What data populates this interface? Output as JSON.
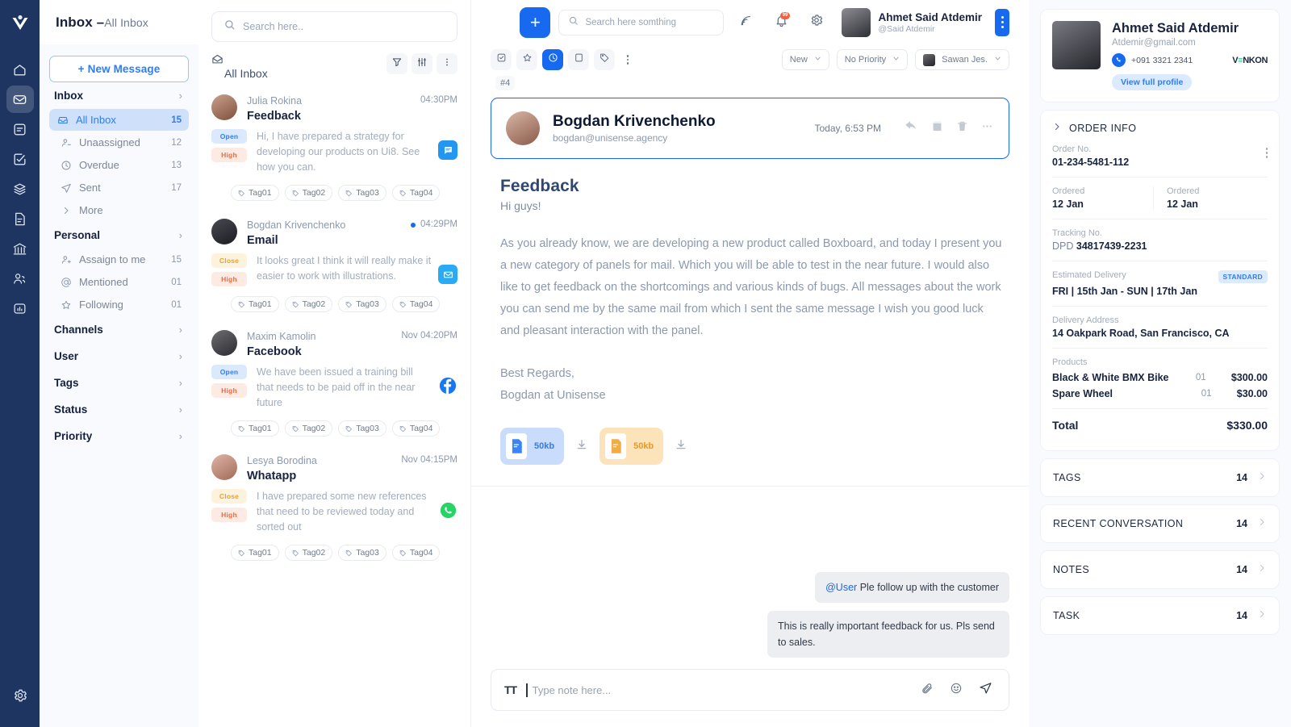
{
  "rail": {
    "logo_icon": "vexel-logo-icon",
    "items": [
      {
        "icon": "home-icon",
        "active": false
      },
      {
        "icon": "inbox-envelope-icon",
        "active": true
      },
      {
        "icon": "notes-icon",
        "active": false
      },
      {
        "icon": "tasks-check-icon",
        "active": false
      },
      {
        "icon": "layers-icon",
        "active": false
      },
      {
        "icon": "document-icon",
        "active": false
      },
      {
        "icon": "bank-icon",
        "active": false
      },
      {
        "icon": "contacts-icon",
        "active": false
      },
      {
        "icon": "analytics-icon",
        "active": false
      }
    ],
    "settings_icon": "gear-icon"
  },
  "sidebar": {
    "title": "Inbox –",
    "subtitle": "All Inbox",
    "new_message_label": "New Message",
    "sections": [
      {
        "label": "Inbox"
      },
      {
        "label": "Personal"
      },
      {
        "label": "Channels"
      },
      {
        "label": "User"
      },
      {
        "label": "Tags"
      },
      {
        "label": "Status"
      },
      {
        "label": "Priority"
      }
    ],
    "inbox_items": [
      {
        "label": "All Inbox",
        "count": "15",
        "icon": "inbox-icon",
        "active": true
      },
      {
        "label": "Unaassigned",
        "count": "12",
        "icon": "user-minus-icon",
        "active": false
      },
      {
        "label": "Overdue",
        "count": "13",
        "icon": "clock-icon",
        "active": false
      },
      {
        "label": "Sent",
        "count": "17",
        "icon": "send-icon",
        "active": false
      },
      {
        "label": "More",
        "count": "",
        "icon": "chevron-right-icon",
        "active": false
      }
    ],
    "personal_items": [
      {
        "label": "Assaign to me",
        "count": "15",
        "icon": "user-plus-icon"
      },
      {
        "label": "Mentioned",
        "count": "01",
        "icon": "at-icon"
      },
      {
        "label": "Following",
        "count": "01",
        "icon": "star-icon"
      }
    ]
  },
  "list": {
    "search_placeholder": "Search here..",
    "header_label": "All Inbox",
    "header_icon": "open-envelope-icon",
    "actions": [
      {
        "icon": "filter-icon"
      },
      {
        "icon": "sliders-icon"
      },
      {
        "icon": "kebab-icon"
      }
    ],
    "messages": [
      {
        "name": "Julia Rokina",
        "time": "04:30PM",
        "subject": "Feedback",
        "preview": "Hi, I have prepared a strategy for developing our products on Ui8. See how you can.",
        "status_badge": "Open",
        "priority_badge": "High",
        "channel": "chat",
        "unread": false,
        "tags": [
          "Tag01",
          "Tag02",
          "Tag03",
          "Tag04"
        ]
      },
      {
        "name": "Bogdan Krivenchenko",
        "time": "04:29PM",
        "subject": "Email",
        "preview": "It looks great I think it will really make it easier to work with illustrations.",
        "status_badge": "Close",
        "priority_badge": "High",
        "channel": "email",
        "unread": true,
        "tags": [
          "Tag01",
          "Tag02",
          "Tag03",
          "Tag04"
        ]
      },
      {
        "name": "Maxim Kamolin",
        "time": "Nov 04:20PM",
        "subject": "Facebook",
        "preview": "We have been issued a training bill that needs to be paid off in the near future",
        "status_badge": "Open",
        "priority_badge": "High",
        "channel": "facebook",
        "unread": false,
        "tags": [
          "Tag01",
          "Tag02",
          "Tag03",
          "Tag04"
        ]
      },
      {
        "name": "Lesya Borodina",
        "time": "Nov 04:15PM",
        "subject": "Whatapp",
        "preview": "I have prepared some new references that need to be reviewed today and sorted out",
        "status_badge": "Close",
        "priority_badge": "High",
        "channel": "whatsapp",
        "unread": false,
        "tags": [
          "Tag01",
          "Tag02",
          "Tag03",
          "Tag04"
        ]
      }
    ]
  },
  "topbar": {
    "add_label": "+",
    "search_placeholder": "Search here somthing",
    "icons": [
      {
        "name": "signal-icon"
      },
      {
        "name": "notification-bell-icon",
        "badge": "99"
      },
      {
        "name": "gear-icon"
      }
    ],
    "user_name": "Ahmet Said Atdemir",
    "user_handle": "@Said Atdemir"
  },
  "mail_toolbar": {
    "buttons": [
      {
        "icon": "check-square-icon",
        "active": false
      },
      {
        "icon": "star-icon",
        "active": false
      },
      {
        "icon": "clock-icon",
        "active": true
      },
      {
        "icon": "archive-icon",
        "active": false
      },
      {
        "icon": "tag-icon",
        "active": false
      }
    ],
    "status_select": "New",
    "priority_select": "No Priority",
    "assignee_select": "Sawan Jes.",
    "thread_number": "#4"
  },
  "mail": {
    "sender_name": "Bogdan Krivenchenko",
    "sender_email": "bogdan@unisense.agency",
    "date": "Today, 6:53 PM",
    "actions": [
      {
        "icon": "reply-icon"
      },
      {
        "icon": "archive-box-icon"
      },
      {
        "icon": "trash-icon"
      },
      {
        "icon": "more-dots-icon"
      }
    ],
    "subject": "Feedback",
    "greeting": "Hi guys!",
    "paragraph": "As you already know, we are developing a new product called Boxboard, and today I present you a new category of panels for mail. Which you will be able to test in the near future. I would also like to get feedback on the shortcomings and various kinds of bugs. All messages about the work you can send me by the same mail from which I sent the same message I wish you good luck and pleasant interaction with the panel.",
    "signoff_line1": "Best Regards,",
    "signoff_line2": "Bogdan at Unisense",
    "attachments": [
      {
        "size": "50kb",
        "color": "blue"
      },
      {
        "size": "50kb",
        "color": "orange"
      }
    ],
    "comments": [
      {
        "mention": "@User",
        "text": "Ple follow up with the customer"
      },
      {
        "mention": "",
        "text": "This is really important feedback for us. Pls send to sales."
      }
    ]
  },
  "composer": {
    "format_label": "TT",
    "placeholder": "Type note here...",
    "actions": [
      {
        "icon": "attachment-icon"
      },
      {
        "icon": "emoji-icon"
      },
      {
        "icon": "send-icon"
      }
    ]
  },
  "right_panel": {
    "contact": {
      "name": "Ahmet Said Atdemir",
      "email": "Atdemir@gmail.com",
      "phone": "+091 3321 2341",
      "brand_pre": "V",
      "brand_mid": "≡",
      "brand_post": "NKON",
      "view_profile_label": "View full profile"
    },
    "order": {
      "header": "ORDER INFO",
      "order_no_label": "Order No.",
      "order_no_value": "01-234-5481-112",
      "ordered_label_1": "Ordered",
      "ordered_value_1": "12 Jan",
      "ordered_label_2": "Ordered",
      "ordered_value_2": "12 Jan",
      "tracking_label": "Tracking No.",
      "tracking_carrier": "DPD",
      "tracking_value": "34817439-2231",
      "delivery_label": "Estimated Delivery",
      "delivery_badge": "STANDARD",
      "delivery_value": "FRI  |  15th Jan - SUN  |  17th Jan",
      "address_label": "Delivery Address",
      "address_value": "14 Oakpark Road, San Francisco, CA",
      "products_label": "Products",
      "products": [
        {
          "name": "Black & White BMX Bike",
          "qty": "01",
          "price": "$300.00"
        },
        {
          "name": "Spare Wheel",
          "qty": "01",
          "price": "$30.00"
        }
      ],
      "total_label": "Total",
      "total_value": "$330.00"
    },
    "accordions": [
      {
        "label": "TAGS",
        "count": "14"
      },
      {
        "label": "RECENT CONVERSATION",
        "count": "14"
      },
      {
        "label": "NOTES",
        "count": "14"
      },
      {
        "label": "TASK",
        "count": "14"
      }
    ]
  },
  "colors": {
    "accent": "#1769f0",
    "rail_bg": "#1e3461",
    "sidebar_bg": "#f8fafd",
    "open_badge": "#2f7df4",
    "close_badge": "#e0a43a",
    "high_badge": "#f3683a"
  }
}
